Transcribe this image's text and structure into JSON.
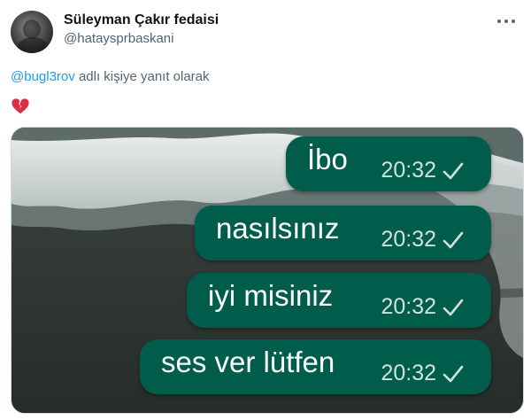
{
  "author": {
    "display_name": "Süleyman Çakır fedaisi",
    "handle": "@hataysprbaskani"
  },
  "reply_context": {
    "mention": "@bugl3rov",
    "text": "adlı kişiye yanıt olarak"
  },
  "tweet_body_emoji": "broken-heart-icon",
  "colors": {
    "bubble": "#005c4b",
    "link": "#1d9bf0",
    "muted": "#536471",
    "broken_heart": "#dd2e44"
  },
  "chat": {
    "messages": [
      {
        "text": "İbo",
        "time": "20:32",
        "status": "sent-check-icon"
      },
      {
        "text": "nasılsınız",
        "time": "20:32",
        "status": "sent-check-icon"
      },
      {
        "text": "iyi misiniz",
        "time": "20:32",
        "status": "sent-check-icon"
      },
      {
        "text": "ses ver lütfen",
        "time": "20:32",
        "status": "sent-check-icon"
      }
    ]
  }
}
